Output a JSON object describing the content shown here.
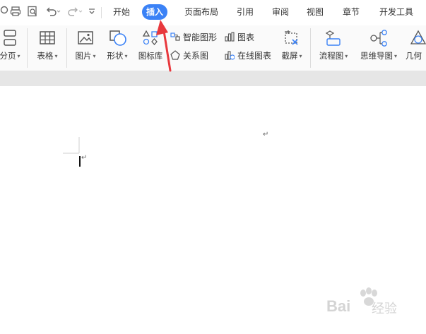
{
  "tabs": [
    {
      "label": "开始"
    },
    {
      "label": "插入"
    },
    {
      "label": "页面布局"
    },
    {
      "label": "引用"
    },
    {
      "label": "审阅"
    },
    {
      "label": "视图"
    },
    {
      "label": "章节"
    },
    {
      "label": "开发工具"
    }
  ],
  "active_tab": "插入",
  "ribbon": {
    "fenye": "分页",
    "biaoge": "表格",
    "tupian": "图片",
    "xingzhuang": "形状",
    "tubiaoku": "图标库",
    "zhineng": "智能图形",
    "guanxi": "关系图",
    "tubiao": "图表",
    "zaixian": "在线图表",
    "jieping": "截屏",
    "liucheng": "流程图",
    "siwei": "思维导图",
    "jihe": "几何"
  },
  "document": {
    "paragraph_mark": "↵"
  },
  "watermark": {
    "brand": "Bai",
    "brand2": "经验"
  },
  "colors": {
    "accent": "#3b82f6",
    "arrow": "#e8383d"
  }
}
